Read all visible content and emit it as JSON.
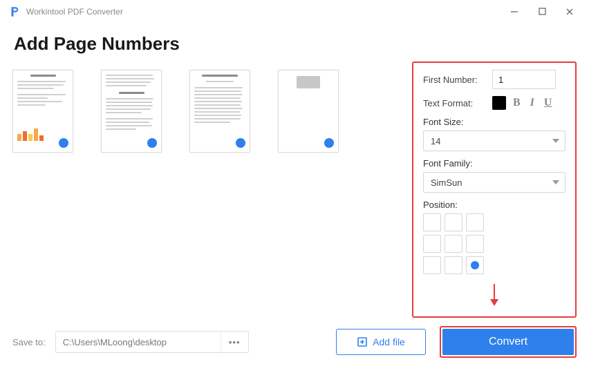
{
  "app": {
    "title": "Workintool PDF Converter"
  },
  "heading": "Add Page Numbers",
  "panel": {
    "first_number_label": "First Number:",
    "first_number_value": "1",
    "text_format_label": "Text Format:",
    "font_size_label": "Font Size:",
    "font_size_value": "14",
    "font_family_label": "Font Family:",
    "font_family_value": "SimSun",
    "position_label": "Position:",
    "selected_position": "bottom-right"
  },
  "bottom": {
    "save_to_label": "Save to:",
    "save_path": "C:\\Users\\MLoong\\desktop",
    "more": "•••",
    "add_file": "Add file",
    "convert": "Convert"
  },
  "thumbnails": {
    "count": 4
  }
}
